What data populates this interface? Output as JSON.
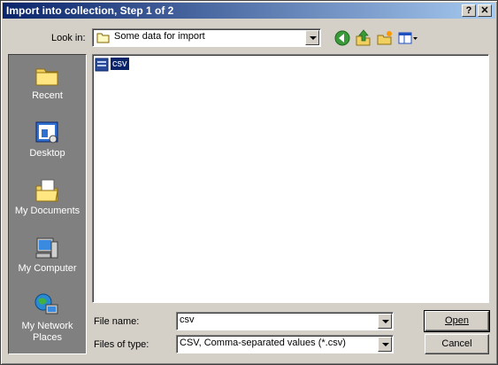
{
  "window": {
    "title": "Import into collection, Step 1 of 2",
    "help_button": "?",
    "close_button": "✕"
  },
  "lookin": {
    "label": "Look in:",
    "value": "Some data for import"
  },
  "toolbar": {
    "icons": [
      "back-icon",
      "up-folder-icon",
      "new-folder-icon",
      "views-menu-icon"
    ]
  },
  "places": [
    {
      "label": "Recent",
      "icon": "recent-folder-icon"
    },
    {
      "label": "Desktop",
      "icon": "desktop-icon"
    },
    {
      "label": "My Documents",
      "icon": "my-documents-icon"
    },
    {
      "label": "My Computer",
      "icon": "my-computer-icon"
    },
    {
      "label": "My Network Places",
      "icon": "network-places-icon"
    }
  ],
  "files": [
    {
      "name": "csv",
      "icon": "csv-file-icon",
      "selected": true
    }
  ],
  "filename": {
    "label": "File name:",
    "value": "csv"
  },
  "filetype": {
    "label": "Files of type:",
    "value": "CSV, Comma-separated values (*.csv)"
  },
  "buttons": {
    "open": "Open",
    "cancel": "Cancel"
  },
  "colors": {
    "title_start": "#0a246a",
    "title_end": "#a6caf0",
    "face": "#d4d0c8",
    "places_bg": "#808080",
    "selection": "#0a246a"
  }
}
